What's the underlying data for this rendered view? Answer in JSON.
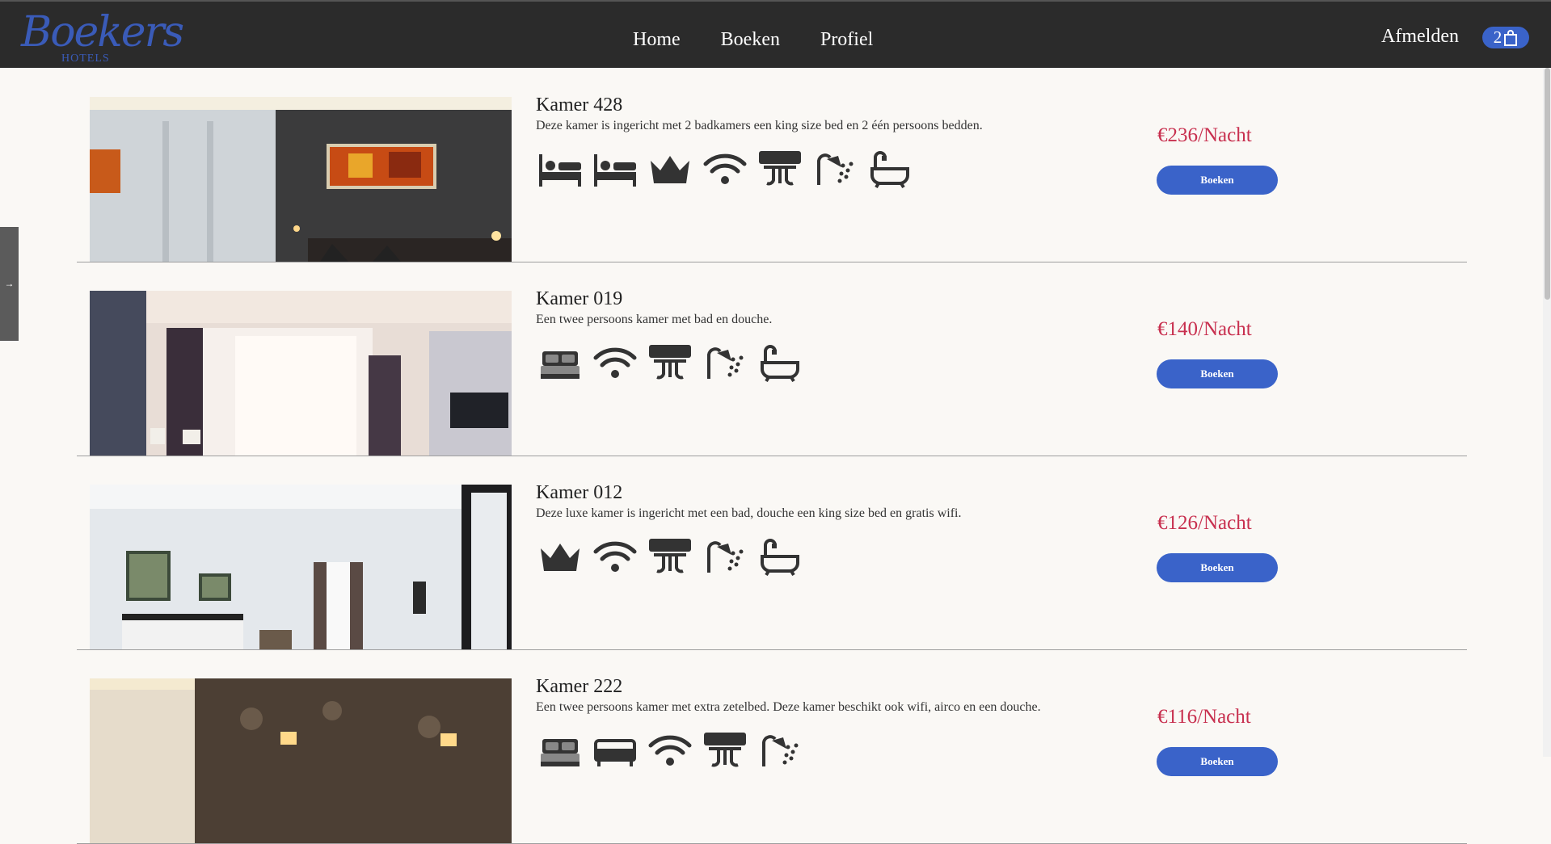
{
  "brand": {
    "name": "Boekers",
    "sub": "HOTELS",
    "color": "#3a5bb8"
  },
  "nav": {
    "items": [
      {
        "label": "Home"
      },
      {
        "label": "Boeken"
      },
      {
        "label": "Profiel"
      }
    ],
    "logout": "Afmelden",
    "cart_count": "2"
  },
  "side_tab": {
    "icon": "arrow-right-icon",
    "glyph": "→"
  },
  "rooms": [
    {
      "title": "Kamer 428",
      "description": "Deze kamer is ingericht met 2 badkamers een king size bed en 2 één persoons bedden.",
      "price": "€236/Nacht",
      "book_label": "Boeken",
      "amenities": [
        "single-bed-icon",
        "single-bed-icon",
        "crown-icon",
        "wifi-icon",
        "airco-icon",
        "shower-icon",
        "bathtub-icon"
      ]
    },
    {
      "title": "Kamer 019",
      "description": "Een twee persoons kamer met bad en douche.",
      "price": "€140/Nacht",
      "book_label": "Boeken",
      "amenities": [
        "double-bed-icon",
        "wifi-icon",
        "airco-icon",
        "shower-icon",
        "bathtub-icon"
      ]
    },
    {
      "title": "Kamer 012",
      "description": "Deze luxe kamer is ingericht met een bad, douche een king size bed en gratis wifi.",
      "price": "€126/Nacht",
      "book_label": "Boeken",
      "amenities": [
        "crown-icon",
        "wifi-icon",
        "airco-icon",
        "shower-icon",
        "bathtub-icon"
      ]
    },
    {
      "title": "Kamer 222",
      "description": "Een twee persoons kamer met extra zetelbed. Deze kamer beschikt ook wifi, airco en een douche.",
      "price": "€116/Nacht",
      "book_label": "Boeken",
      "amenities": [
        "double-bed-icon",
        "sofa-icon",
        "wifi-icon",
        "airco-icon",
        "shower-icon"
      ]
    }
  ],
  "colors": {
    "navbar": "#2b2b2b",
    "accent": "#3a63c9",
    "price": "#c8304f",
    "background": "#faf8f5"
  }
}
